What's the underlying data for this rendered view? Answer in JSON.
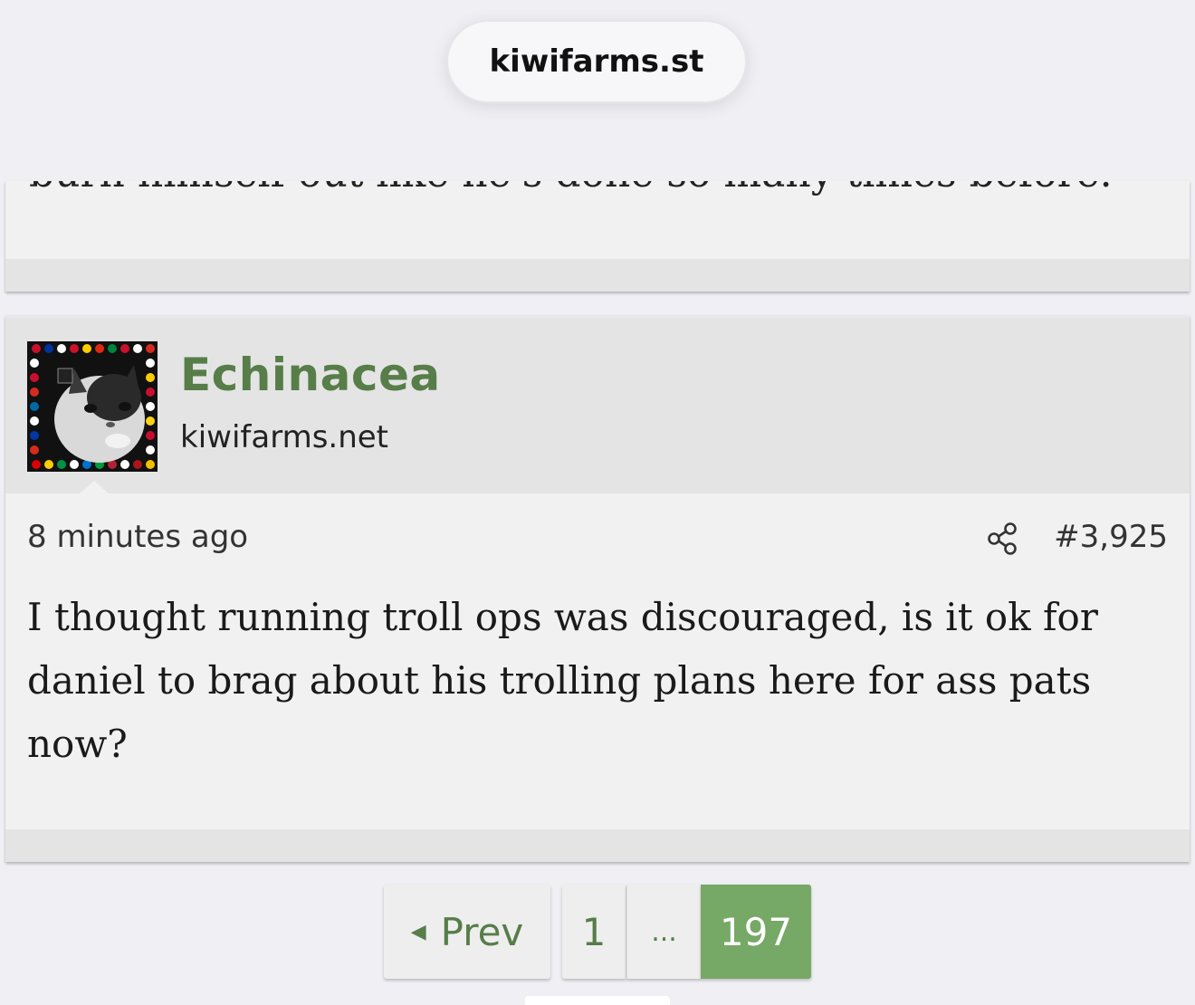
{
  "browser": {
    "url": "kiwifarms.st"
  },
  "previous_post": {
    "partial_text": "burn himself out like he's done so many times before."
  },
  "post": {
    "author": {
      "username": "Echinacea",
      "title": "kiwifarms.net"
    },
    "timestamp": "8 minutes ago",
    "post_number": "#3,925",
    "body": "I thought running troll ops was discouraged, is it ok for daniel to brag about his trolling plans here for ass pats now?",
    "icons": {
      "share": "share-icon",
      "avatar": "cat-avatar"
    }
  },
  "pagination": {
    "prev_label": "Prev",
    "pages": [
      "1",
      "...",
      "197"
    ],
    "current": "197"
  },
  "colors": {
    "accent": "#577d48",
    "current_page_bg": "#76a866",
    "header_bg": "#e4e4e4",
    "post_bg": "#f1f1f1"
  }
}
